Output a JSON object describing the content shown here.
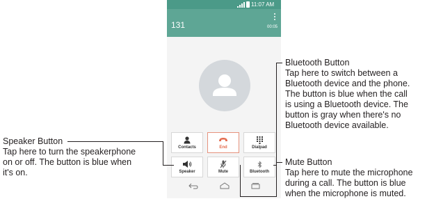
{
  "status_bar": {
    "time": "11:07 AM"
  },
  "call": {
    "number": "131",
    "duration": "00:05"
  },
  "buttons": {
    "contacts": {
      "label": "Contacts",
      "icon": "person-icon"
    },
    "end": {
      "label": "End",
      "icon": "end-call-icon"
    },
    "dialpad": {
      "label": "Dialpad",
      "icon": "dialpad-icon"
    },
    "speaker": {
      "label": "Speaker",
      "icon": "speaker-icon"
    },
    "mute": {
      "label": "Mute",
      "icon": "mic-muted-icon"
    },
    "bluetooth": {
      "label": "Bluetooth",
      "icon": "bluetooth-icon"
    }
  },
  "annotations": {
    "bluetooth": {
      "title": "Bluetooth Button",
      "lines": [
        "Tap here to switch between a",
        "Bluetooth device and the phone.",
        "The button is blue when the call",
        "is using a Bluetooth device. The",
        "button is gray when there's no",
        "Bluetooth device available."
      ]
    },
    "speaker": {
      "title": "Speaker Button",
      "lines": [
        "Tap here to turn the speakerphone",
        "on or off. The button is blue when",
        "it's on."
      ]
    },
    "mute": {
      "title": "Mute Button",
      "lines": [
        "Tap here to mute the microphone",
        "during a call. The button is blue",
        "when the microphone is muted."
      ]
    }
  },
  "colors": {
    "header": "#5ea695",
    "status_bar": "#4b9a88",
    "end_accent": "#e36b4e"
  }
}
